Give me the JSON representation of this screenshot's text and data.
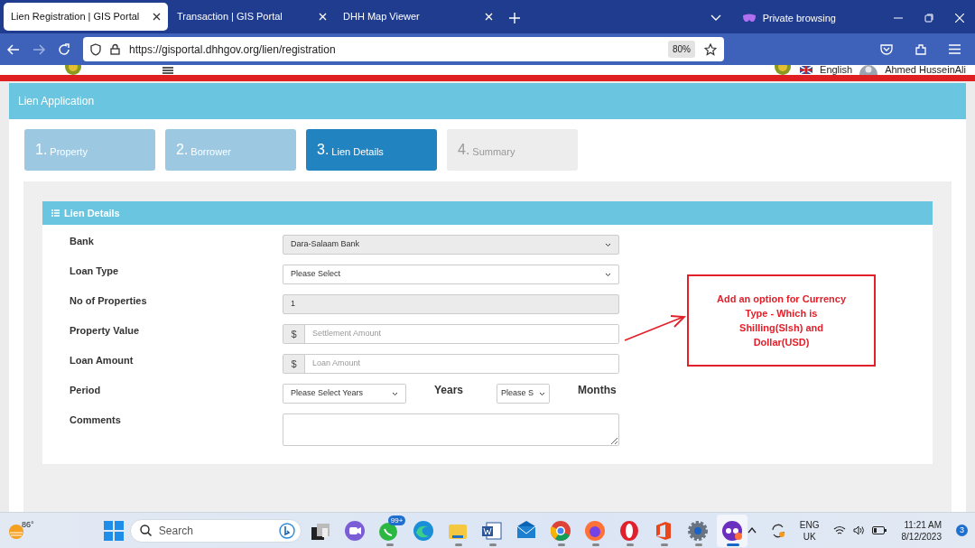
{
  "browser": {
    "tabs": [
      {
        "title": "Lien Registration | GIS Portal",
        "selected": true
      },
      {
        "title": "Transaction | GIS Portal",
        "selected": false
      },
      {
        "title": "DHH Map Viewer",
        "selected": false
      }
    ],
    "private_label": "Private browsing",
    "url": "https://gisportal.dhhgov.org/lien/registration",
    "zoom": "80%"
  },
  "site_header": {
    "language": "English",
    "user": "Ahmed HusseinAli"
  },
  "panel_title": "Lien Application",
  "steps": [
    {
      "number": "1.",
      "label": "Property",
      "selected": false,
      "completed": true
    },
    {
      "number": "2.",
      "label": "Borrower",
      "selected": false,
      "completed": true
    },
    {
      "number": "3.",
      "label": "Lien Details",
      "selected": true,
      "completed": false
    },
    {
      "number": "4.",
      "label": "Summary",
      "selected": false,
      "completed": false
    }
  ],
  "card_title": "Lien Details",
  "fields": [
    {
      "label": "Bank",
      "kind": "select",
      "value": "Dara-Salaam Bank",
      "disabled": true
    },
    {
      "label": "Loan Type",
      "kind": "select",
      "value": "Please Select",
      "disabled": false
    },
    {
      "label": "No of Properties",
      "kind": "input",
      "value": "1",
      "disabled": true
    },
    {
      "label": "Property Value",
      "kind": "addon",
      "addon": "$",
      "placeholder": "Settlement Amount"
    },
    {
      "label": "Loan Amount",
      "kind": "addon",
      "addon": "$",
      "placeholder": "Loan Amount"
    },
    {
      "label": "Period",
      "kind": "period",
      "years_value": "Please Select Years",
      "years_label": "Years",
      "months_value": "Please S",
      "months_label": "Months"
    },
    {
      "label": "Comments",
      "kind": "textarea"
    }
  ],
  "annotation": "Add an option for Currency Type - Which is Shilling(Slsh) and Dollar(USD)",
  "taskbar": {
    "weather": "86°",
    "search_placeholder": "Search",
    "apps": [
      {
        "kind": "taskview",
        "running": false,
        "selected": false
      },
      {
        "kind": "meet",
        "running": false,
        "selected": false
      },
      {
        "kind": "whatsapp",
        "badge": "99+",
        "running": true,
        "selected": false
      },
      {
        "kind": "edge",
        "running": false,
        "selected": false
      },
      {
        "kind": "folder",
        "running": true,
        "selected": false
      },
      {
        "kind": "word",
        "running": true,
        "selected": false
      },
      {
        "kind": "mail",
        "running": false,
        "selected": false
      },
      {
        "kind": "chrome",
        "running": true,
        "selected": false
      },
      {
        "kind": "firefox",
        "running": true,
        "selected": false
      },
      {
        "kind": "opera",
        "running": true,
        "selected": false
      },
      {
        "kind": "office",
        "running": true,
        "selected": false
      },
      {
        "kind": "settings",
        "running": true,
        "selected": false
      },
      {
        "kind": "private",
        "running": true,
        "selected": true
      }
    ],
    "language": "ENG",
    "region": "UK",
    "time": "11:21 AM",
    "date": "8/12/2023",
    "notifications": "3"
  }
}
